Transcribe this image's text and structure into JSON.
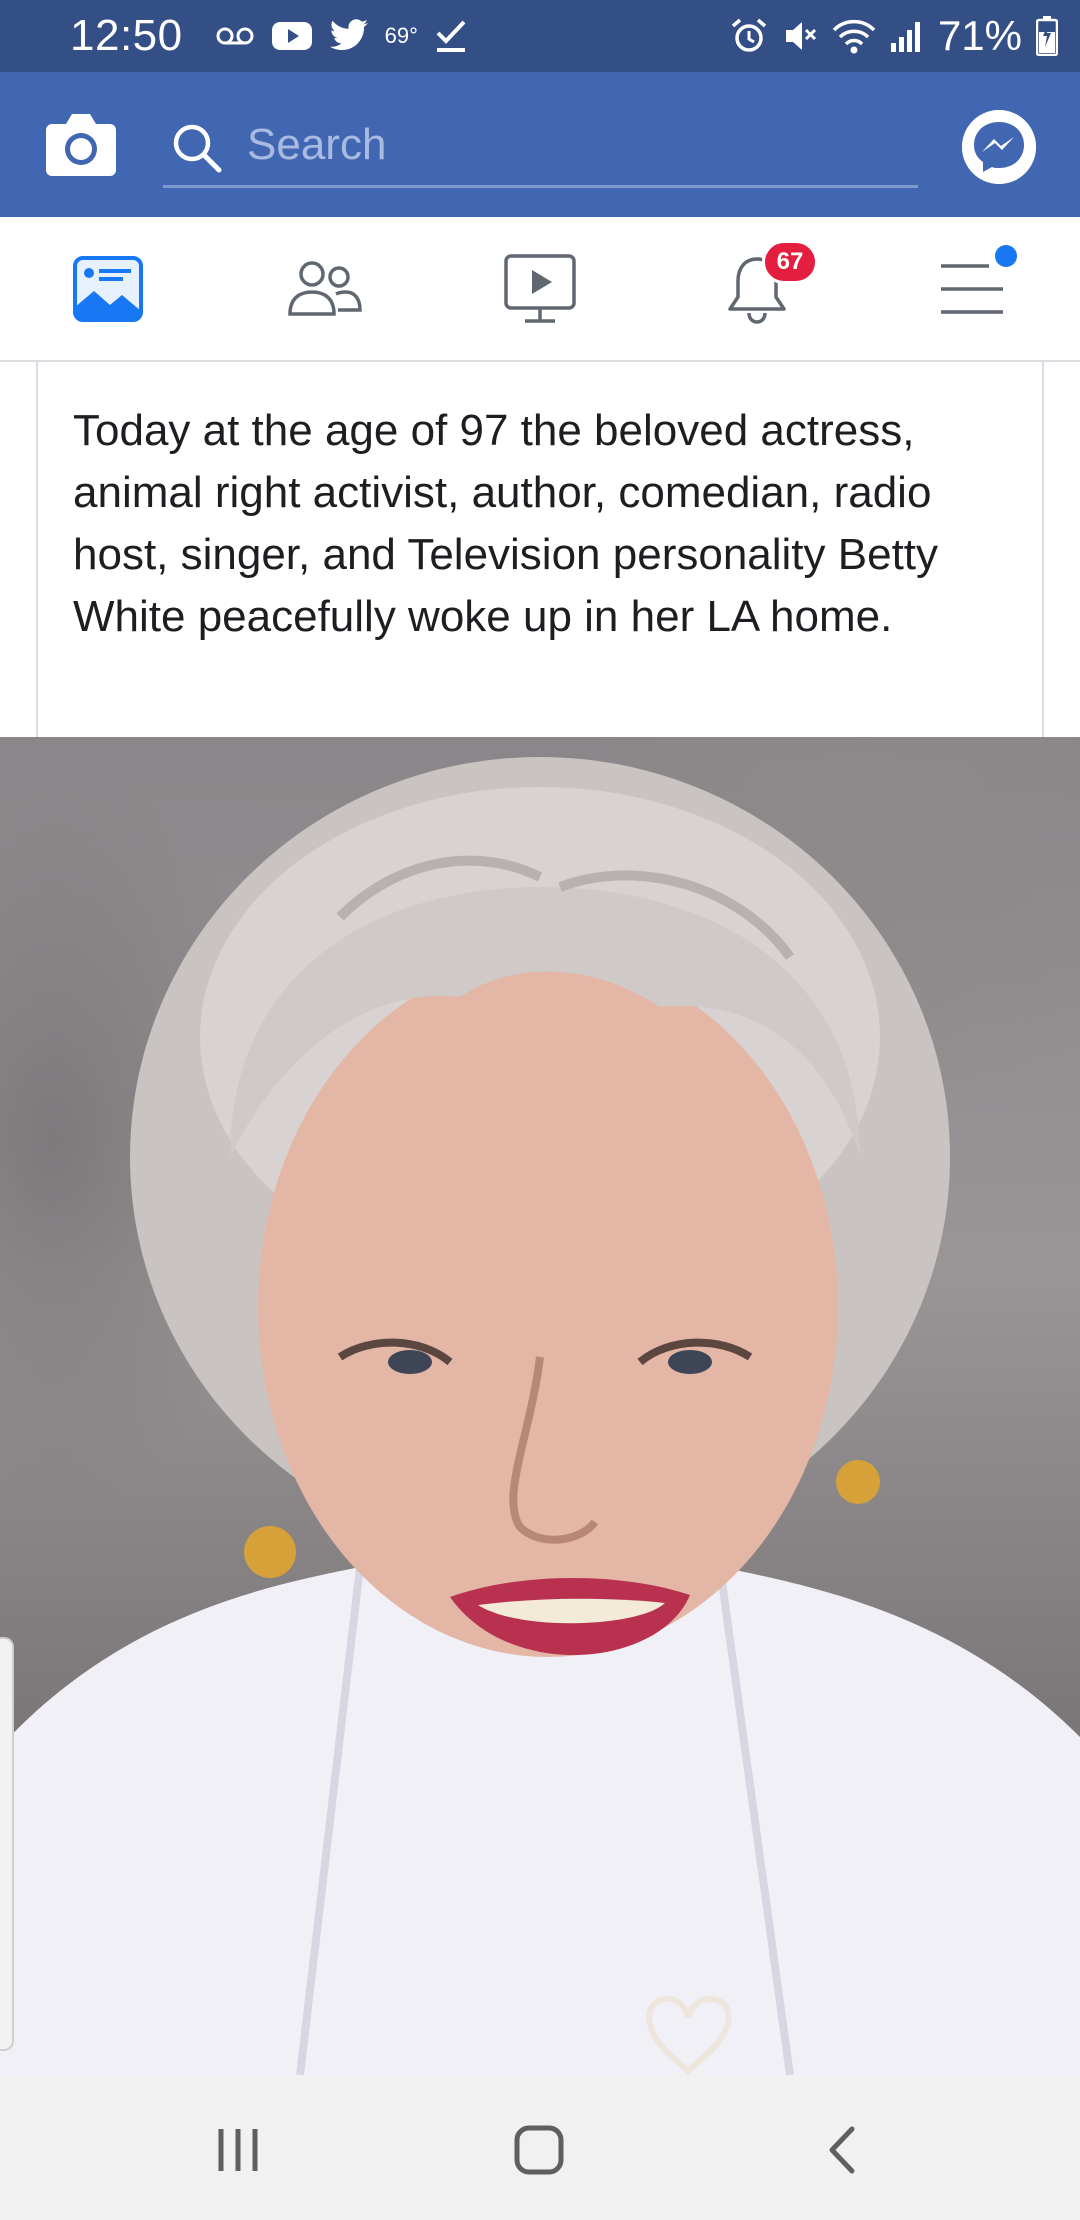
{
  "status_bar": {
    "time": "12:50",
    "temperature": "69°",
    "battery": "71%",
    "left_icons": [
      "voicemail-icon",
      "youtube-icon",
      "twitter-icon",
      "checkmark-icon"
    ],
    "right_icons": [
      "alarm-icon",
      "mute-icon",
      "wifi-icon",
      "signal-icon",
      "battery-icon"
    ]
  },
  "app_bar": {
    "search_placeholder": "Search",
    "icons": [
      "camera-icon",
      "search-icon",
      "messenger-icon"
    ]
  },
  "tabs": [
    {
      "name": "news-feed",
      "icon": "news-feed-icon",
      "active": true
    },
    {
      "name": "friends",
      "icon": "friends-icon"
    },
    {
      "name": "watch",
      "icon": "watch-icon"
    },
    {
      "name": "notifications",
      "icon": "bell-icon",
      "badge": "67"
    },
    {
      "name": "menu",
      "icon": "hamburger-menu-icon",
      "dot": true
    }
  ],
  "post": {
    "text": "Today at the age of 97 the beloved actress, animal right activist, author, comedian, radio host, singer, and Television personality Betty White peacefully woke up in her LA home."
  },
  "nav_bar": {
    "icons": [
      "recents-icon",
      "home-icon",
      "back-icon"
    ]
  },
  "colors": {
    "status_bar": "#344e86",
    "app_bar": "#4267b2",
    "accent_blue": "#1877f2",
    "badge_red": "#e41e3f",
    "tab_inactive": "#606770"
  }
}
